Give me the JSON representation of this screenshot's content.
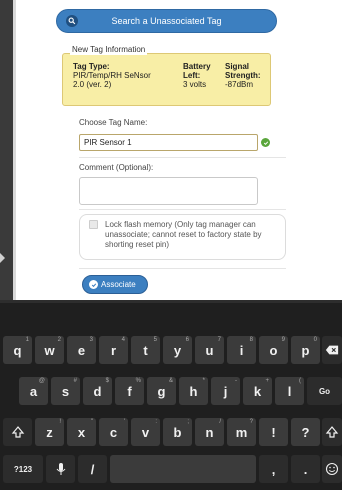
{
  "search_button": {
    "label": "Search a Unassociated Tag"
  },
  "tag_info": {
    "legend": "New Tag Information",
    "tag_type": {
      "header": "Tag Type:",
      "line1": "PIR/Temp/RH SeNsor",
      "line2": "2.0 (ver. 2)"
    },
    "battery": {
      "header_line1": "Battery",
      "header_line2": "Left:",
      "value": "3 volts"
    },
    "signal": {
      "header_line1": "Signal",
      "header_line2": "Strength:",
      "value": "-87dBm"
    }
  },
  "tag_name": {
    "label": "Choose Tag Name:",
    "value": "PIR Sensor 1"
  },
  "comment": {
    "label": "Comment (Optional):",
    "value": ""
  },
  "lock_flash": {
    "label": "Lock flash memory (Only tag manager can unassociate; cannot reset to factory state by shorting reset pin)",
    "checked": false
  },
  "associate_button": {
    "label": "Associate"
  },
  "keyboard": {
    "row1": [
      {
        "key": "q",
        "sub": "1"
      },
      {
        "key": "w",
        "sub": "2"
      },
      {
        "key": "e",
        "sub": "3"
      },
      {
        "key": "r",
        "sub": "4"
      },
      {
        "key": "t",
        "sub": "5"
      },
      {
        "key": "y",
        "sub": "6"
      },
      {
        "key": "u",
        "sub": "7"
      },
      {
        "key": "i",
        "sub": "8"
      },
      {
        "key": "o",
        "sub": "9"
      },
      {
        "key": "p",
        "sub": "0"
      }
    ],
    "row2": [
      {
        "key": "a",
        "sub": "@"
      },
      {
        "key": "s",
        "sub": "#"
      },
      {
        "key": "d",
        "sub": "$"
      },
      {
        "key": "f",
        "sub": "%"
      },
      {
        "key": "g",
        "sub": "&"
      },
      {
        "key": "h",
        "sub": "*"
      },
      {
        "key": "j",
        "sub": "-"
      },
      {
        "key": "k",
        "sub": "+"
      },
      {
        "key": "l",
        "sub": "("
      }
    ],
    "row3": [
      {
        "key": "z",
        "sub": "!"
      },
      {
        "key": "x",
        "sub": "\""
      },
      {
        "key": "c",
        "sub": "'"
      },
      {
        "key": "v",
        "sub": ":"
      },
      {
        "key": "b",
        "sub": ";"
      },
      {
        "key": "n",
        "sub": "/"
      },
      {
        "key": "m",
        "sub": "?"
      },
      {
        "key": "!",
        "sub": ""
      },
      {
        "key": "?",
        "sub": ""
      }
    ],
    "go_label": "Go",
    "symbols_label": "?123",
    "slash_label": "/",
    "comma_label": ",",
    "period_label": "."
  }
}
